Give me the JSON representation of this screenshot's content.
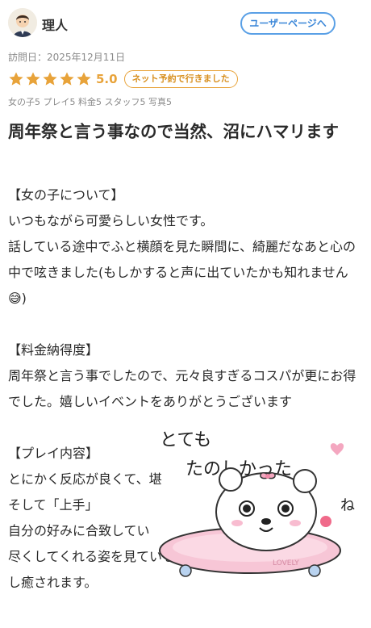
{
  "header": {
    "username": "理人",
    "user_page_label": "ユーザーページへ"
  },
  "review": {
    "visit_date": "訪問日：2025年12月11日",
    "rating": "5.0",
    "stars": 5,
    "visit_badge": "ネット予約で行きました",
    "subscores": "女の子5 プレイ5 料金5 スタッフ5 写真5",
    "title": "周年祭と言う事なので当然、沼にハマリます",
    "body_lines": [
      "【女の子について】",
      "いつもながら可愛らしい女性です。",
      "話している途中でふと横顔を見た瞬間に、綺麗だなあと心の中で呟きました(もしかすると声に出ていたかも知れません😅)",
      "",
      "【料金納得度】",
      "周年祭と言う事でしたので、元々良すぎるコスパが更にお得でした。嬉しいイベントをありがとうございます",
      "",
      "【プレイ内容】",
      "とにかく反応が良くて、堪",
      "そして「上手」",
      "自分の好みに合致してい",
      "尽くしてくれる姿を見ているだけでも満たされます",
      "し癒されます。"
    ]
  },
  "sticker": {
    "text_line1": "とても",
    "text_line2": "たのしかった",
    "text_side": "ね",
    "board_text": "LOVELY"
  },
  "colors": {
    "accent_blue": "#3a86d8",
    "star_orange": "#e8a33a",
    "muted_gray": "#8a8a8a"
  }
}
